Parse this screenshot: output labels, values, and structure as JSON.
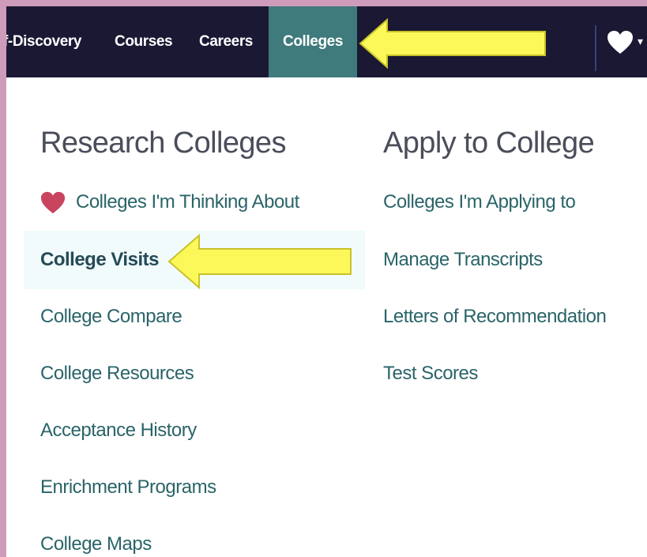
{
  "nav": {
    "items": [
      "f-Discovery",
      "Courses",
      "Careers",
      "Colleges"
    ],
    "active": "Colleges",
    "favorites_icon": "heart-icon",
    "menu_caret": "▾"
  },
  "menu": {
    "research": {
      "title": "Research Colleges",
      "links": [
        "Colleges I'm Thinking About",
        "College Visits",
        "College Compare",
        "College Resources",
        "Acceptance History",
        "Enrichment Programs",
        "College Maps"
      ]
    },
    "apply": {
      "title": "Apply to College",
      "links": [
        "Colleges I'm Applying to",
        "Manage Transcripts",
        "Letters of Recommendation",
        "Test Scores"
      ]
    }
  },
  "colors": {
    "nav_bg": "#1a1833",
    "active_tab": "#3f7a7c",
    "link": "#2a6468",
    "arrow": "#fcf85a",
    "heart": "#c9445e"
  }
}
